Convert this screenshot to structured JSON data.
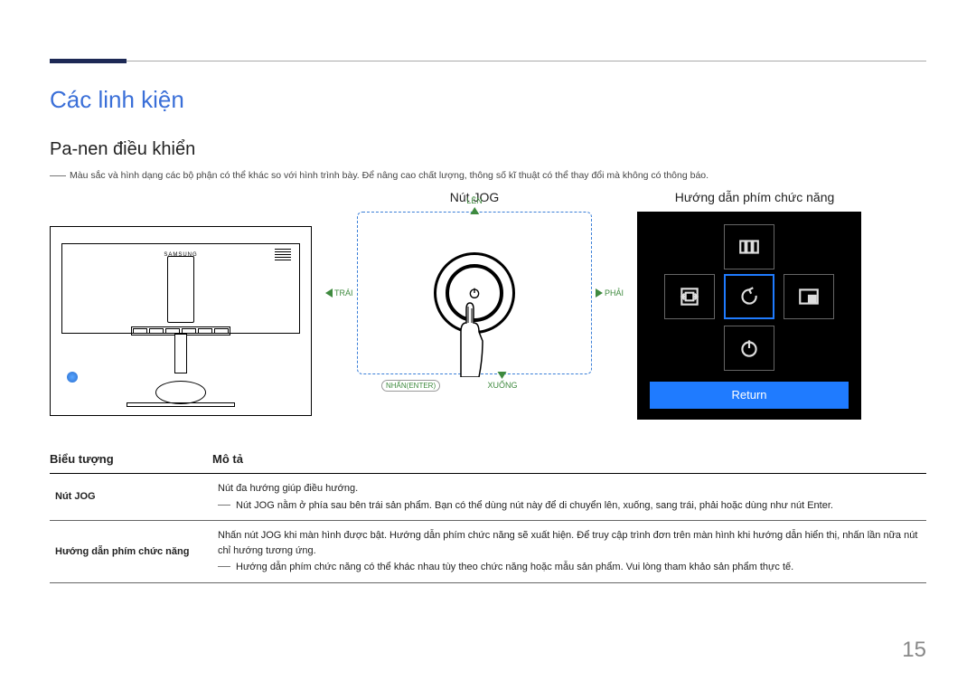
{
  "section_title": "Các linh kiện",
  "subsection_title": "Pa-nen điều khiển",
  "top_note": "Màu sắc và hình dạng các bộ phận có thể khác so với hình trình bày. Để nâng cao chất lượng, thông số kĩ thuật có thể thay đổi mà không có thông báo.",
  "monitor_brand": "SAMSUNG",
  "jog": {
    "title": "Nút JOG",
    "up": "LÊN",
    "down": "XUỐNG",
    "left": "TRÁI",
    "right": "PHẢI",
    "enter": "NHẤN(ENTER)"
  },
  "osd": {
    "title": "Hướng dẫn phím chức năng",
    "return_label": "Return"
  },
  "table": {
    "col_icon": "Biểu tượng",
    "col_desc": "Mô tả",
    "rows": [
      {
        "label": "Nút JOG",
        "line1": "Nút đa hướng giúp điều hướng.",
        "note": "Nút JOG nằm ở phía sau bên trái sản phẩm. Bạn có thể dùng nút này để di chuyển lên, xuống, sang trái, phải hoặc dùng như nút Enter."
      },
      {
        "label": "Hướng dẫn phím chức năng",
        "line1": "Nhấn nút JOG khi màn hình được bật. Hướng dẫn phím chức năng sẽ xuất hiện. Để truy cập trình đơn trên màn hình khi hướng dẫn hiển thị, nhấn lần nữa nút chỉ hướng tương ứng.",
        "note": "Hướng dẫn phím chức năng có thể khác nhau tùy theo chức năng hoặc mẫu sản phẩm. Vui lòng tham khảo sản phẩm thực tế."
      }
    ]
  },
  "page_number": "15"
}
